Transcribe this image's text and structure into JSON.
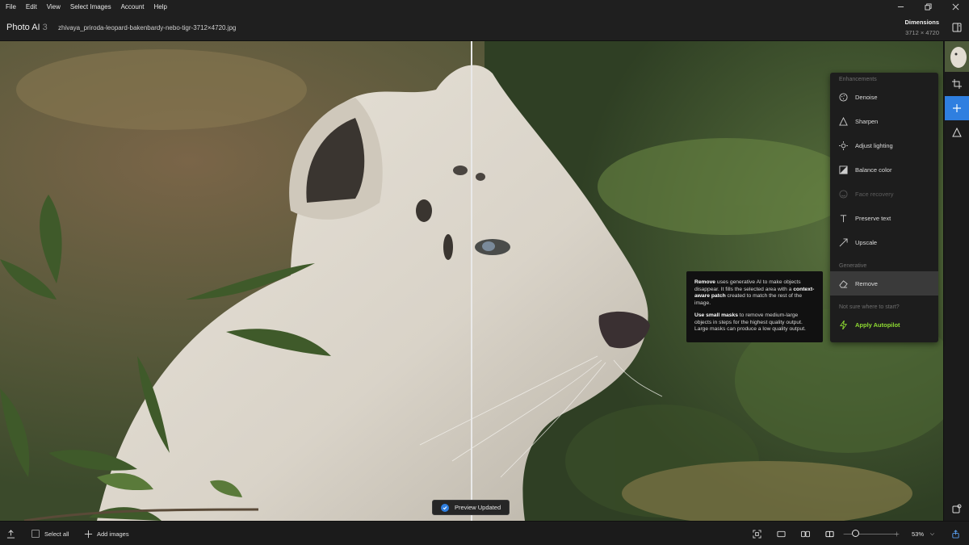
{
  "menu": [
    "File",
    "Edit",
    "View",
    "Select Images",
    "Account",
    "Help"
  ],
  "header": {
    "app_name": "Photo AI",
    "app_version": "3",
    "file_name": "zhivaya_priroda-leopard-bakenbardy-nebo-tigr-3712×4720.jpg",
    "dimensions_label": "Dimensions",
    "dimensions_value": "3712 × 4720"
  },
  "panel": {
    "enhancements_title": "Enhancements",
    "items": [
      {
        "label": "Denoise",
        "icon": "denoise-icon"
      },
      {
        "label": "Sharpen",
        "icon": "sharpen-icon"
      },
      {
        "label": "Adjust lighting",
        "icon": "lighting-icon"
      },
      {
        "label": "Balance color",
        "icon": "balance-color-icon"
      },
      {
        "label": "Face recovery",
        "icon": "face-icon"
      },
      {
        "label": "Preserve text",
        "icon": "text-icon"
      },
      {
        "label": "Upscale",
        "icon": "upscale-icon"
      }
    ],
    "generative_title": "Generative",
    "remove_label": "Remove",
    "hint": "Not sure where to start?",
    "autopilot_label": "Apply Autopilot",
    "autopilot_color": "#8fdc32"
  },
  "tooltip": {
    "p1_bold": "Remove",
    "p1_a": " uses generative AI to make objects disappear. It fills the selected area with a ",
    "p1_bold2": "context-aware patch",
    "p1_b": " created to match the rest of the image.",
    "p2_bold": "Use small masks",
    "p2_a": " to remove medium-large objects in steps for the highest quality output. Large masks can produce a low quality output."
  },
  "toast": {
    "text": "Preview Updated"
  },
  "bottombar": {
    "select_all": "Select all",
    "add_images": "Add images",
    "zoom": "53%",
    "zoom_level": 0.2
  },
  "colors": {
    "accent": "#2f7fe0"
  }
}
